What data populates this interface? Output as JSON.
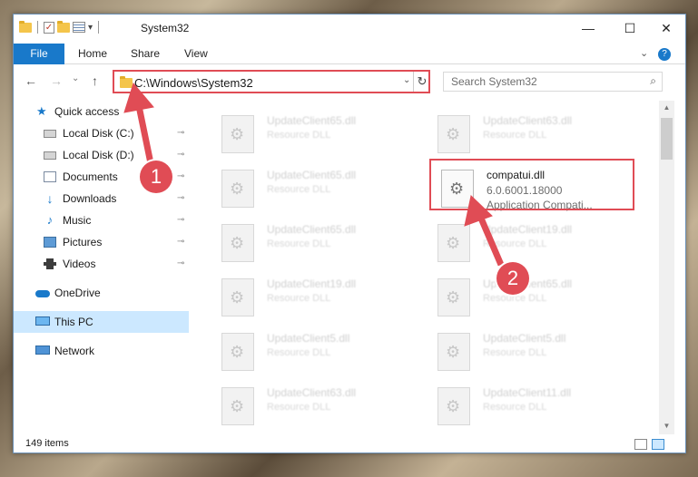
{
  "window": {
    "title": "System32"
  },
  "titlebar": {
    "minimize": "—",
    "maximize": "☐",
    "close": "✕",
    "qat_dropdown": "▾",
    "qat_check": "✓"
  },
  "ribbon": {
    "tabs": [
      "File",
      "Home",
      "Share",
      "View"
    ],
    "expand": "⌄",
    "help": "?"
  },
  "nav": {
    "back": "←",
    "forward": "→",
    "recent": "⌄",
    "up": "↑"
  },
  "address": {
    "path": "C:\\Windows\\System32",
    "dropdown": "⌄",
    "refresh": "↻"
  },
  "search": {
    "placeholder": "Search System32",
    "icon": "⌕"
  },
  "sidebar": {
    "items": [
      {
        "label": "Quick access",
        "icon": "star-icon",
        "pinned": false
      },
      {
        "label": "Local Disk (C:)",
        "icon": "disk-icon",
        "pinned": true
      },
      {
        "label": "Local Disk (D:)",
        "icon": "disk-icon",
        "pinned": true
      },
      {
        "label": "Documents",
        "icon": "documents-icon",
        "pinned": true
      },
      {
        "label": "Downloads",
        "icon": "download-icon",
        "pinned": true
      },
      {
        "label": "Music",
        "icon": "music-icon",
        "pinned": true
      },
      {
        "label": "Pictures",
        "icon": "pictures-icon",
        "pinned": true
      },
      {
        "label": "Videos",
        "icon": "videos-icon",
        "pinned": true
      },
      {
        "label": "OneDrive",
        "icon": "cloud-icon",
        "pinned": false
      },
      {
        "label": "This PC",
        "icon": "pc-icon",
        "pinned": false
      },
      {
        "label": "Network",
        "icon": "network-icon",
        "pinned": false
      }
    ],
    "pin_glyph": "📌",
    "star_glyph": "★",
    "download_glyph": "↓",
    "music_glyph": "♪"
  },
  "files": {
    "left": [
      {
        "name": "UpdateClient65.dll",
        "desc": "Resource DLL"
      },
      {
        "name": "UpdateClient65.dll",
        "desc": "Resource DLL"
      },
      {
        "name": "UpdateClient65.dll",
        "desc": "Resource DLL"
      },
      {
        "name": "UpdateClient19.dll",
        "desc": "Resource DLL"
      },
      {
        "name": "UpdateClient5.dll",
        "desc": "Resource DLL"
      },
      {
        "name": "UpdateClient63.dll",
        "desc": "Resource DLL"
      }
    ],
    "right": [
      {
        "name": "UpdateClient63.dll",
        "desc": "Resource DLL"
      },
      {
        "name": "compatui.dll",
        "version": "6.0.6001.18000",
        "desc": "Application Compati..."
      },
      {
        "name": "UpdateClient19.dll",
        "desc": "Resource DLL"
      },
      {
        "name": "UpdateClient65.dll",
        "desc": "Resource DLL"
      },
      {
        "name": "UpdateClient5.dll",
        "desc": "Resource DLL"
      },
      {
        "name": "UpdateClient11.dll",
        "desc": "Resource DLL"
      }
    ]
  },
  "status": {
    "items": "149 items"
  },
  "annotations": {
    "step1": "1",
    "step2": "2",
    "color": "#e04c55"
  },
  "scrollbar": {
    "up": "▲",
    "down": "▼"
  }
}
